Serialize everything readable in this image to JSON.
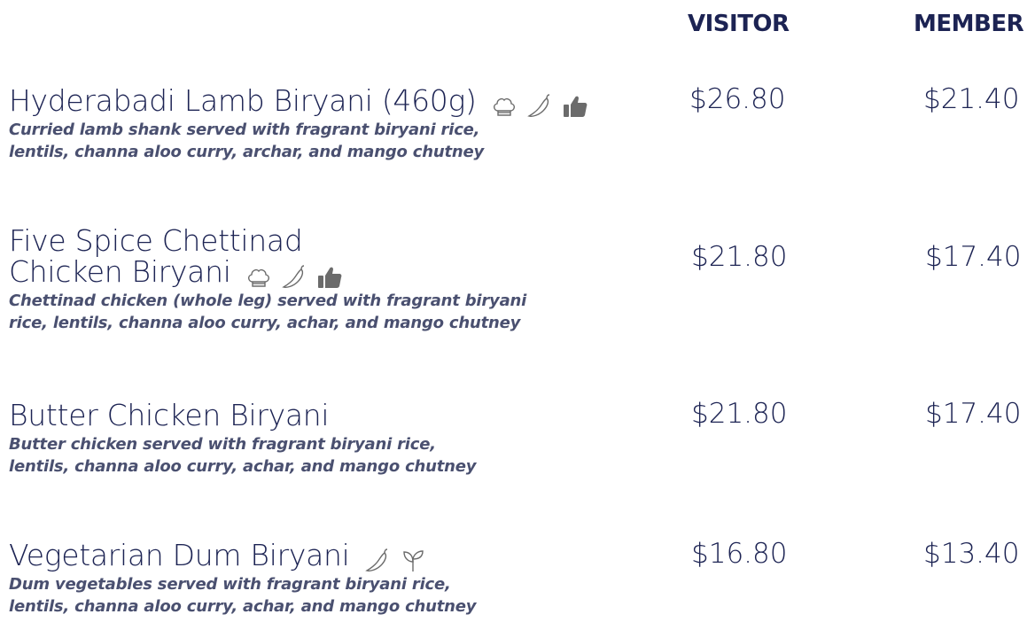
{
  "headers": {
    "visitor": "VISITOR",
    "member": "MEMBER"
  },
  "colors": {
    "primary": "#1c2353",
    "description": "#4a5070",
    "icon": "#6b6b6b"
  },
  "items": [
    {
      "name": "Hyderabadi Lamb Biryani (460g)",
      "icons": [
        "chef-hat-icon",
        "chili-icon",
        "thumbs-up-icon"
      ],
      "description_line1": "Curried lamb shank served with fragrant biryani rice,",
      "description_line2": "lentils, channa aloo curry, archar, and mango chutney",
      "visitor_price": "$26.80",
      "member_price": "$21.40"
    },
    {
      "name_line1": "Five Spice Chettinad",
      "name_line2": "Chicken Biryani",
      "icons": [
        "chef-hat-icon",
        "chili-icon",
        "thumbs-up-icon"
      ],
      "description_line1": "Chettinad chicken (whole leg) served with fragrant biryani",
      "description_line2": "rice, lentils, channa aloo curry, achar, and mango chutney",
      "visitor_price": "$21.80",
      "member_price": "$17.40"
    },
    {
      "name": "Butter Chicken Biryani",
      "icons": [],
      "description_line1": "Butter chicken served with fragrant biryani rice,",
      "description_line2": "lentils, channa aloo curry, achar, and mango chutney",
      "visitor_price": "$21.80",
      "member_price": "$17.40"
    },
    {
      "name": "Vegetarian Dum Biryani",
      "icons": [
        "chili-icon",
        "vegetarian-leaf-icon"
      ],
      "description_line1": "Dum vegetables served with fragrant biryani rice,",
      "description_line2": "lentils, channa aloo curry, achar, and mango chutney",
      "visitor_price": "$16.80",
      "member_price": "$13.40"
    }
  ]
}
